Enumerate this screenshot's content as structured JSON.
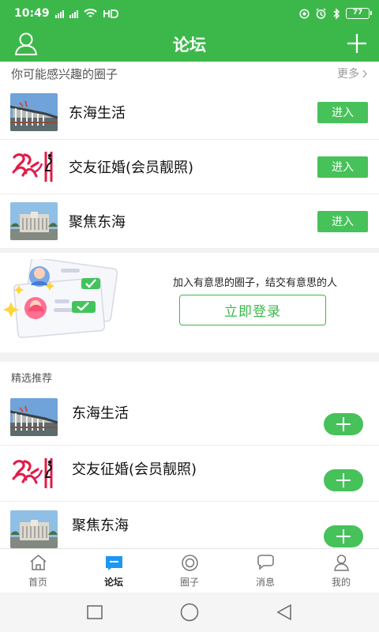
{
  "status": {
    "time": "10:49",
    "battery": "77"
  },
  "header": {
    "title": "论坛",
    "user_icon": "user-icon",
    "add_icon": "plus-icon"
  },
  "interest": {
    "title": "你可能感兴趣的圈子",
    "more": "更多",
    "items": [
      {
        "name": "东海生活",
        "button": "进入",
        "thumb": "building-photo"
      },
      {
        "name": "交友征婚(会员靓照)",
        "button": "进入",
        "thumb": "dating-logo"
      },
      {
        "name": "聚焦东海",
        "button": "进入",
        "thumb": "campus-photo"
      }
    ]
  },
  "login_promo": {
    "text": "加入有意思的圈子，结交有意思的人",
    "button": "立即登录"
  },
  "recommend": {
    "title": "精选推荐",
    "items": [
      {
        "name": "东海生活",
        "thumb": "building-photo"
      },
      {
        "name": "交友征婚(会员靓照)",
        "thumb": "dating-logo"
      },
      {
        "name": "聚焦东海",
        "thumb": "campus-photo"
      }
    ]
  },
  "tabs": [
    {
      "label": "首页",
      "icon": "home-icon"
    },
    {
      "label": "论坛",
      "icon": "forum-icon"
    },
    {
      "label": "圈子",
      "icon": "circle-icon"
    },
    {
      "label": "消息",
      "icon": "message-icon"
    },
    {
      "label": "我的",
      "icon": "profile-icon"
    }
  ],
  "colors": {
    "brand": "#3cb84a",
    "button": "#47c15a"
  }
}
